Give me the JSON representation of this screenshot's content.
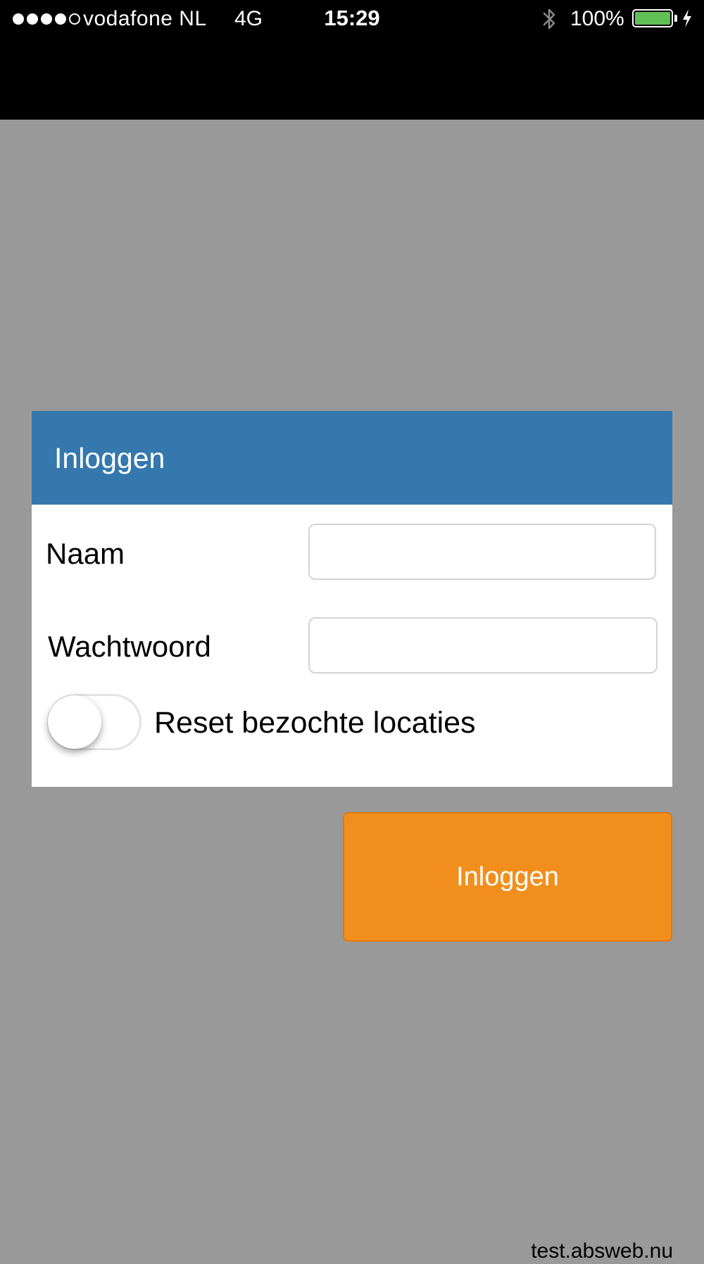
{
  "status_bar": {
    "signal_bars_filled": 4,
    "signal_bars_total": 5,
    "carrier": "vodafone NL",
    "network": "4G",
    "time": "15:29",
    "bluetooth_icon": "bluetooth-icon",
    "battery_percent": "100%",
    "battery_level": 1.0,
    "battery_color": "#5fc055",
    "charging_icon": "charging-bolt-icon"
  },
  "login_panel": {
    "title": "Inloggen",
    "header_color": "#3478ae",
    "name_label": "Naam",
    "name_value": "",
    "password_label": "Wachtwoord",
    "password_value": "",
    "reset_toggle_label": "Reset bezochte locaties",
    "reset_toggle_on": false
  },
  "login_button": {
    "label": "Inloggen",
    "color": "#f28f1c"
  },
  "footer": {
    "host": "test.absweb.nu"
  }
}
